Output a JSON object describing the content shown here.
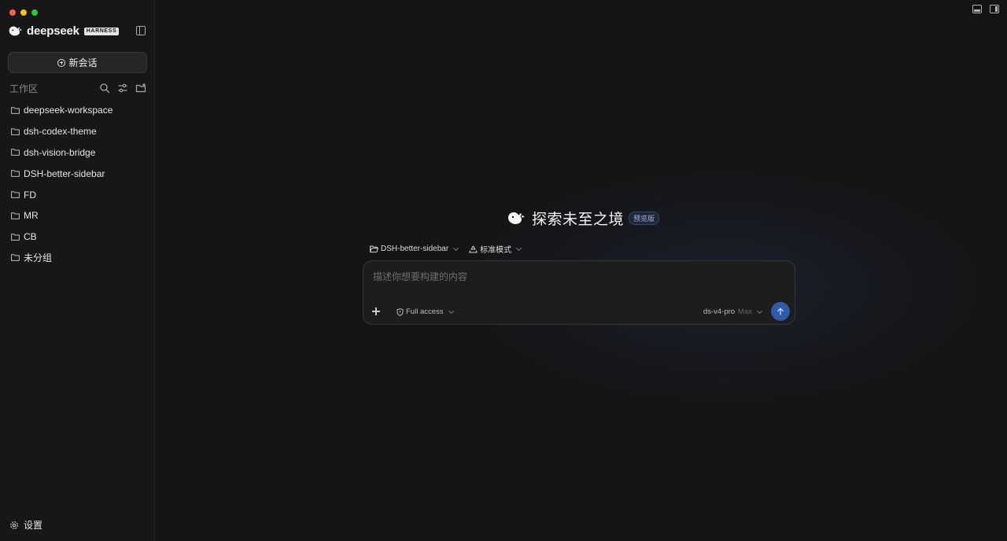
{
  "window": {
    "controls": [
      "close",
      "minimize",
      "zoom"
    ]
  },
  "sidebar": {
    "brand": {
      "logo_icon": "deepseek-whale-icon",
      "name": "deepseek",
      "tag": "HARNESS"
    },
    "new_chat_label": "新会话",
    "workspace": {
      "title": "工作区",
      "tools": [
        "search-icon",
        "filter-icon",
        "new-folder-icon"
      ],
      "folders": [
        {
          "name": "deepseek-workspace"
        },
        {
          "name": "dsh-codex-theme"
        },
        {
          "name": "dsh-vision-bridge"
        },
        {
          "name": "DSH-better-sidebar"
        },
        {
          "name": "FD"
        },
        {
          "name": "MR"
        },
        {
          "name": "CB"
        },
        {
          "name": "未分组"
        }
      ]
    },
    "settings_label": "设置"
  },
  "main": {
    "hero": {
      "title": "探索未至之境",
      "badge": "预览版"
    },
    "selectors": {
      "project": "DSH-better-sidebar",
      "mode": "标准模式"
    },
    "composer": {
      "placeholder": "描述你想要构建的内容",
      "value": "",
      "access": "Full access",
      "model": "ds-v4-pro",
      "effort": "Max"
    }
  },
  "colors": {
    "background": "#141414",
    "sidebar": "#171717",
    "accent": "#2f5aa8",
    "badge_text": "#9db4e0"
  }
}
